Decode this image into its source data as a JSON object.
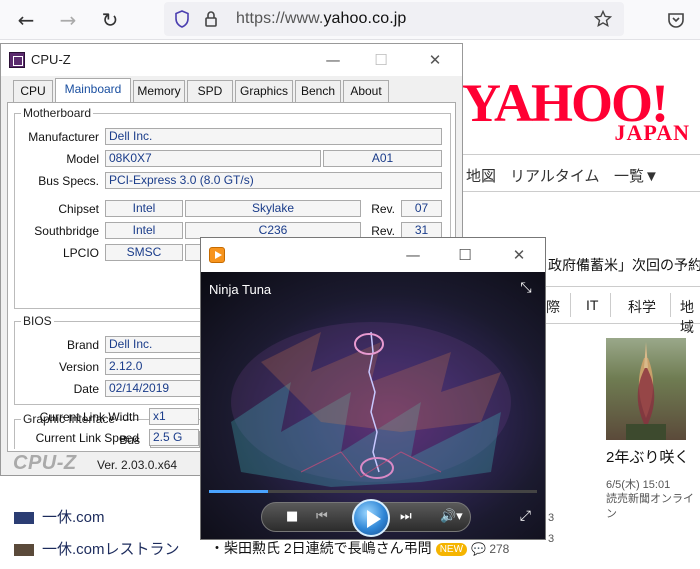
{
  "browser": {
    "url_prefix": "https://www.",
    "url_domain": "yahoo.co.jp",
    "back_icon": "back-arrow-icon",
    "forward_icon": "forward-arrow-icon",
    "reload_icon": "reload-icon"
  },
  "yahoo": {
    "logo_word": "YAHOO!",
    "logo_sub": "JAPAN",
    "nav": [
      "地図",
      "リアルタイム",
      "一覧▼"
    ],
    "headline": "政府備蓄米」次回の予約",
    "categories": [
      "際",
      "IT",
      "科学",
      "地域"
    ],
    "news_headline": "2年ぶり咲く",
    "news_date": "6/5(木) 15:01",
    "news_source": "読売新聞オンライン",
    "left_items": [
      "一休.com",
      "一休.comレストラン"
    ],
    "bottom_news": "・柴田勲氏 2日連続で長嶋さん弔問",
    "new_badge": "NEW",
    "comment_count": "278",
    "side_num1": "3",
    "side_num2": "3",
    "brand_color": "#ff0033"
  },
  "cpuz": {
    "title": "CPU-Z",
    "tabs": [
      "CPU",
      "Mainboard",
      "Memory",
      "SPD",
      "Graphics",
      "Bench",
      "About"
    ],
    "motherboard": {
      "group": "Motherboard",
      "manufacturer_label": "Manufacturer",
      "manufacturer": "Dell Inc.",
      "model_label": "Model",
      "model": "08K0X7",
      "model_rev": "A01",
      "bus_label": "Bus Specs.",
      "bus": "PCI-Express 3.0 (8.0 GT/s)",
      "chipset_label": "Chipset",
      "chipset_vendor": "Intel",
      "chipset_name": "Skylake",
      "rev_label": "Rev.",
      "chipset_rev": "07",
      "southbridge_label": "Southbridge",
      "southbridge_vendor": "Intel",
      "southbridge_name": "C236",
      "southbridge_rev": "31",
      "lpcio_label": "LPCIO",
      "lpcio_vendor": "SMSC"
    },
    "bios": {
      "group": "BIOS",
      "brand_label": "Brand",
      "brand": "Dell Inc.",
      "version_label": "Version",
      "version": "2.12.0",
      "date_label": "Date",
      "date": "02/14/2019"
    },
    "graphic": {
      "group": "Graphic Interface",
      "bus_label": "Bus",
      "bus": "",
      "width_label": "Current Link Width",
      "width": "x1",
      "speed_label": "Current Link Speed",
      "speed": "2.5 G"
    },
    "footer_brand": "CPU-Z",
    "footer_version": "Ver. 2.03.0.x64"
  },
  "player": {
    "track": "Ninja Tuna",
    "progress": 0.18
  }
}
